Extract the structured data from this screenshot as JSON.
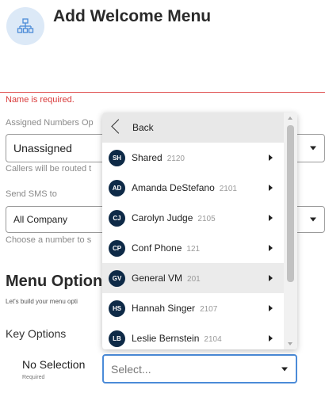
{
  "header": {
    "title": "Add Welcome Menu",
    "icon": "org-chart-icon"
  },
  "name_field": {
    "error": "Name is required."
  },
  "assigned_numbers": {
    "label": "Assigned Numbers Op",
    "value": "Unassigned",
    "helper": "Callers will be routed t"
  },
  "send_sms": {
    "label": "Send SMS to",
    "value": "All Company",
    "helper": "Choose a number to s"
  },
  "menu_options": {
    "title": "Menu Option",
    "subtitle": "Let's build your menu opti"
  },
  "key_options": {
    "label": "Key Options",
    "no_selection": "No Selection",
    "required": "Required",
    "select_placeholder": "Select..."
  },
  "dropdown": {
    "back_label": "Back",
    "items": [
      {
        "initials": "SH",
        "name": "Shared",
        "ext": "2120"
      },
      {
        "initials": "AD",
        "name": "Amanda DeStefano",
        "ext": "2101"
      },
      {
        "initials": "CJ",
        "name": "Carolyn Judge",
        "ext": "2105"
      },
      {
        "initials": "CP",
        "name": "Conf Phone",
        "ext": "121"
      },
      {
        "initials": "GV",
        "name": "General VM",
        "ext": "201"
      },
      {
        "initials": "HS",
        "name": "Hannah Singer",
        "ext": "2107"
      },
      {
        "initials": "LB",
        "name": "Leslie Bernstein",
        "ext": "2104"
      }
    ]
  },
  "colors": {
    "error": "#d93a3a",
    "focus": "#4b8bd8",
    "avatar": "#0e2a47",
    "header_icon_bg": "#dce9f7"
  }
}
